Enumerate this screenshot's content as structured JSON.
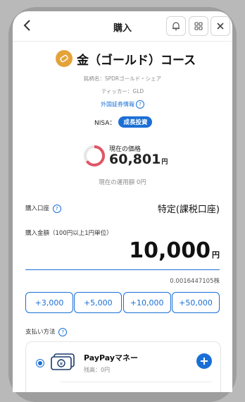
{
  "nav": {
    "title": "購入",
    "back_icon": "chevron-left-icon"
  },
  "asset": {
    "name": "金（ゴールド）コース",
    "issue_name": "銘柄名：SPDRゴールド・シェア",
    "ticker": "ティッカー：GLD",
    "foreign_info": "外国証券情報",
    "nisa_label": "NISA：",
    "nisa_badge": "成長投資"
  },
  "price": {
    "label": "現在の価格",
    "value": "60,801",
    "unit": "円"
  },
  "holdings": {
    "text": "現在の運用額 0円"
  },
  "account": {
    "label": "購入口座",
    "value": "特定(課税口座)"
  },
  "amount": {
    "label": "購入金額（100円以上1円単位）",
    "value": "10,000",
    "unit": "円",
    "shares": "0.0016447105株"
  },
  "quick_add": [
    "+3,000",
    "+5,000",
    "+10,000",
    "+50,000"
  ],
  "payment": {
    "label": "支払い方法",
    "method_name": "PayPayマネー",
    "balance": "残高：0円"
  },
  "colors": {
    "accent": "#1a6fd6",
    "gold": "#e4a33a",
    "gauge": "#e05565"
  }
}
